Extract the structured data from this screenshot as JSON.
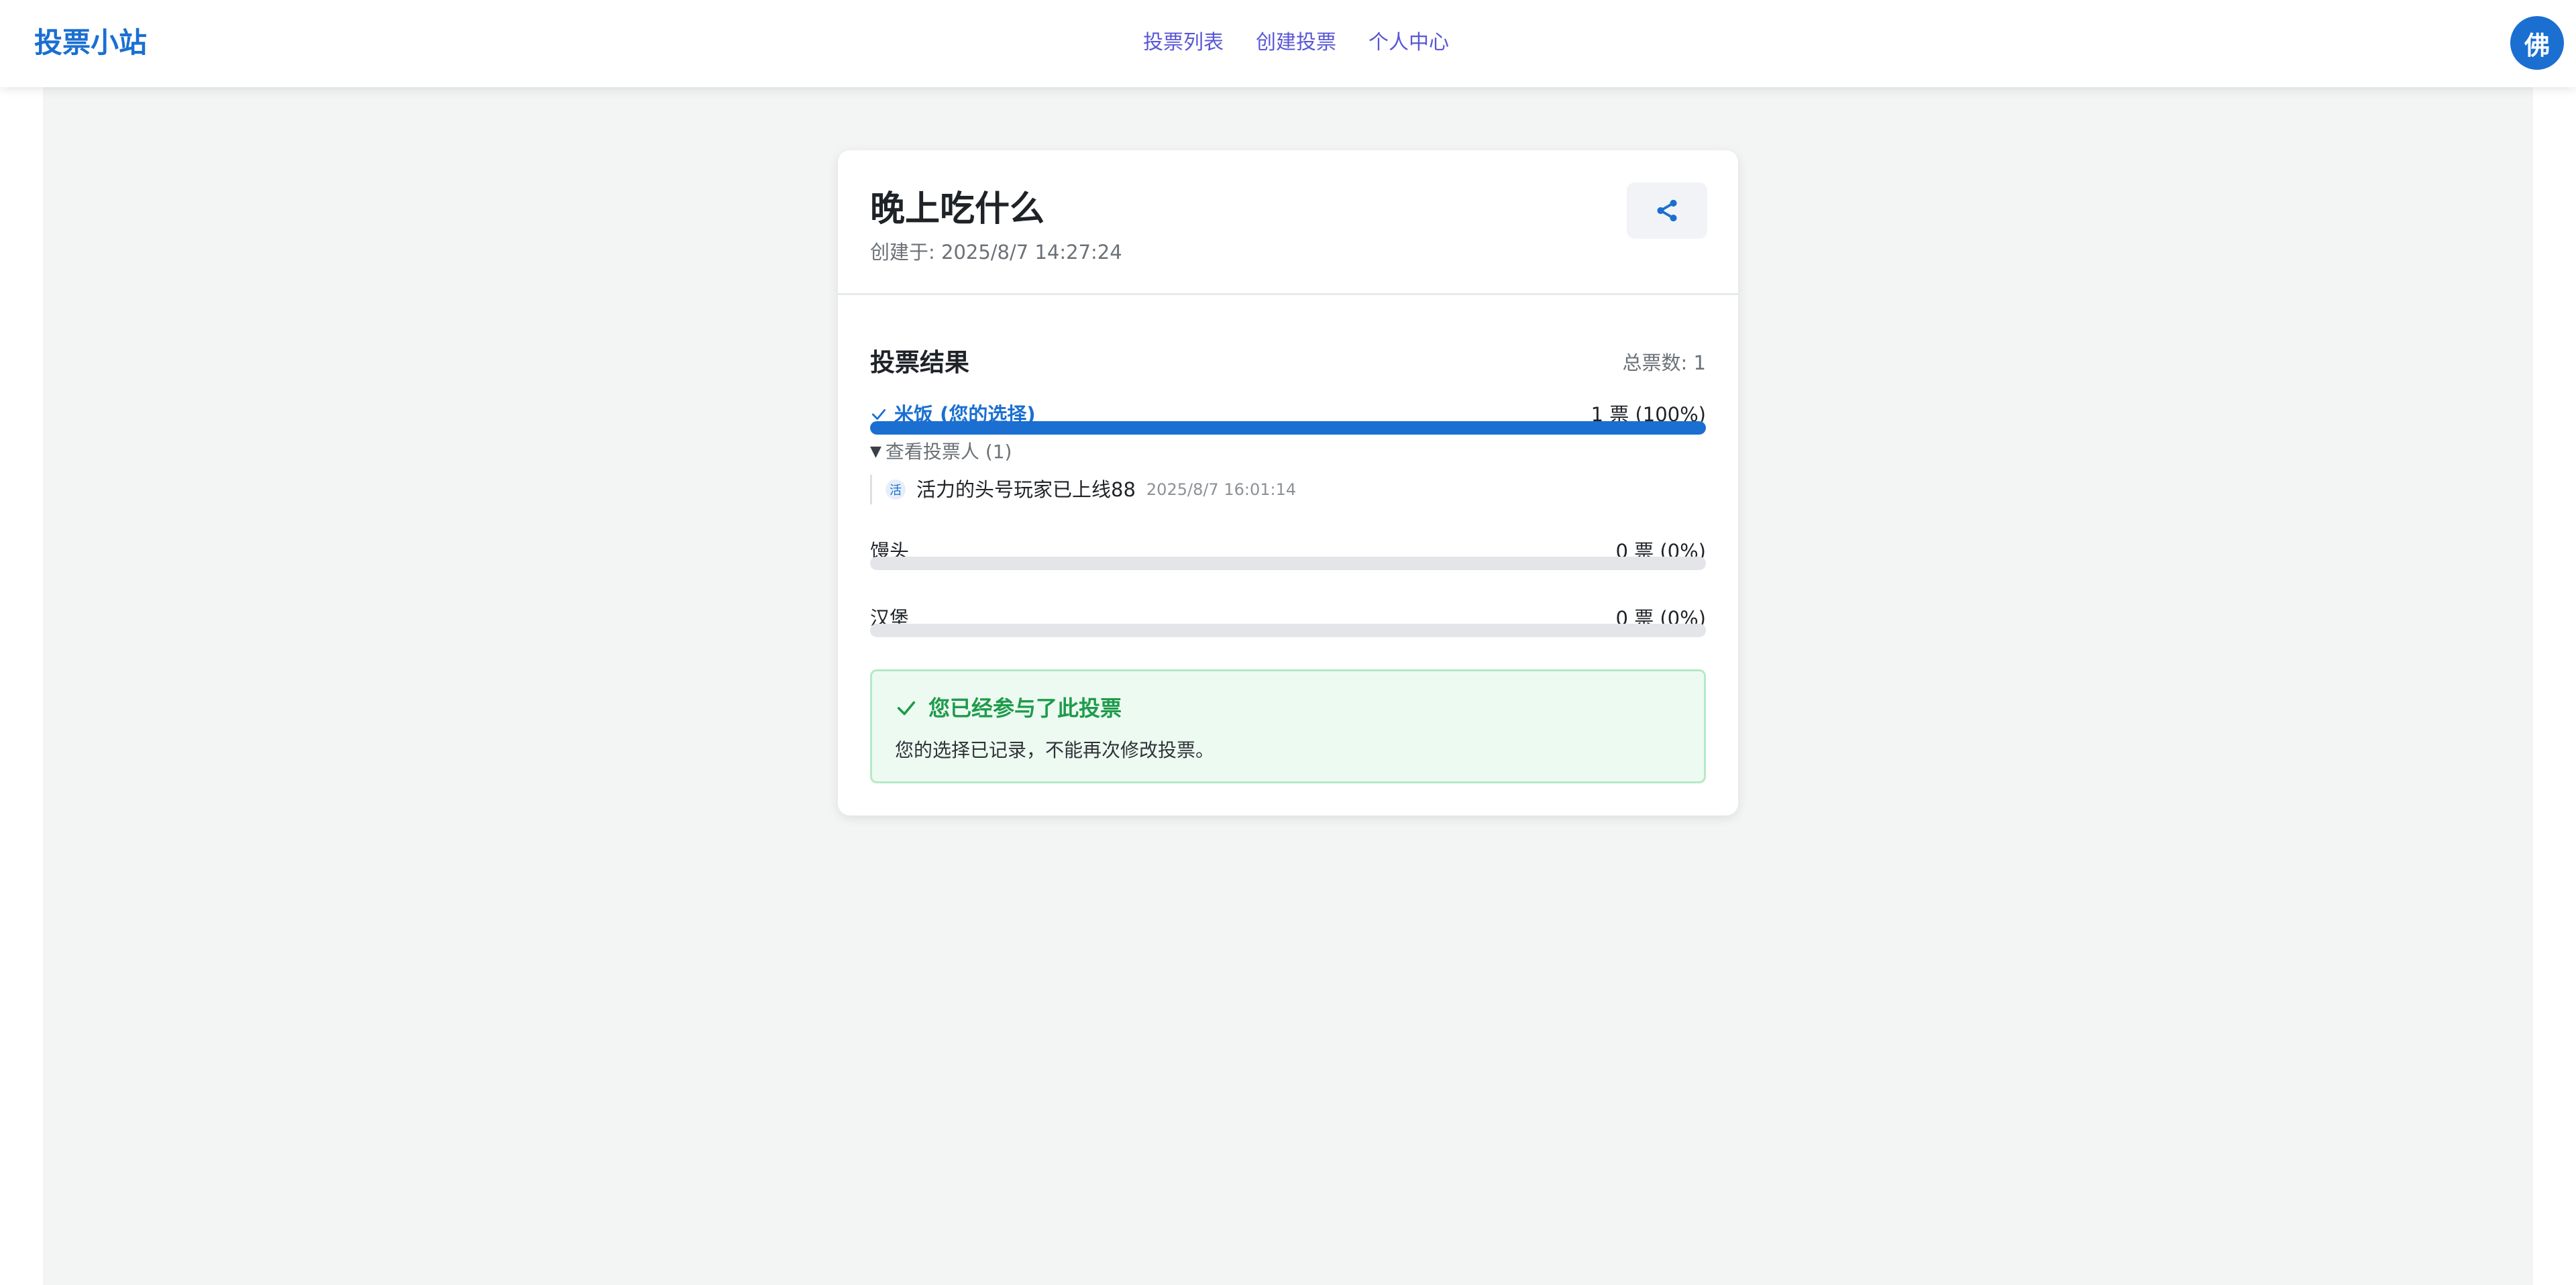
{
  "navbar": {
    "brand": "投票小站",
    "links": [
      {
        "label": "投票列表"
      },
      {
        "label": "创建投票"
      },
      {
        "label": "个人中心"
      }
    ],
    "avatar_text": "佛"
  },
  "poll": {
    "title": "晚上吃什么",
    "created": "创建于: 2025/8/7 14:27:24",
    "share_icon": "share-icon"
  },
  "results": {
    "title": "投票结果",
    "total": "总票数: 1",
    "options": [
      {
        "label": "米饭 (您的选择)",
        "count": "1 票 (100%)",
        "percent": 100,
        "selected": true
      },
      {
        "label": "馒头",
        "count": "0 票 (0%)",
        "percent": 0,
        "selected": false
      },
      {
        "label": "汉堡",
        "count": "0 票 (0%)",
        "percent": 0,
        "selected": false
      }
    ],
    "voters_toggle": "查看投票人 (1)",
    "voters": [
      {
        "avatar": "活",
        "name": "活力的头号玩家已上线88",
        "time": "2025/8/7 16:01:14"
      }
    ]
  },
  "notice": {
    "title": "您已经参与了此投票",
    "text": "您的选择已记录，不能再次修改投票。"
  },
  "colors": {
    "accent": "#1a6fd1",
    "nav_link": "#5a57d6",
    "success": "#1e9b4b",
    "success_bg": "#edfaf1"
  }
}
